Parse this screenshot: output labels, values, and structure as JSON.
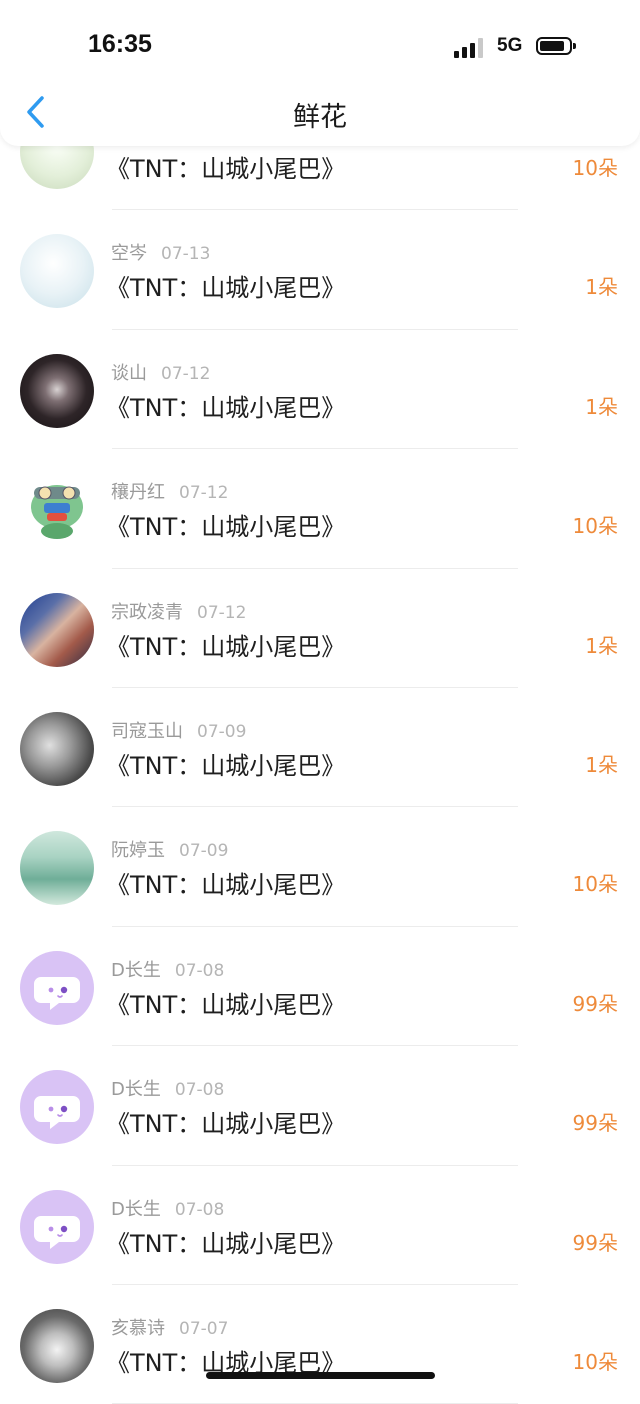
{
  "status_bar": {
    "time": "16:35",
    "network": "5G"
  },
  "header": {
    "title": "鲜花"
  },
  "rows": [
    {
      "name": "",
      "date": "",
      "book": "《TNT：山城小尾巴》",
      "amount": "10朵",
      "avatar": "av-partial",
      "avatar_name": "avatar-icon"
    },
    {
      "name": "空岑",
      "date": "07-13",
      "book": "《TNT：山城小尾巴》",
      "amount": "1朵",
      "avatar": "av-anime",
      "avatar_name": "avatar-icon"
    },
    {
      "name": "谈山",
      "date": "07-12",
      "book": "《TNT：山城小尾巴》",
      "amount": "1朵",
      "avatar": "av-dark",
      "avatar_name": "avatar-icon"
    },
    {
      "name": "穰丹红",
      "date": "07-12",
      "book": "《TNT：山城小尾巴》",
      "amount": "10朵",
      "avatar": "av-cartoon",
      "avatar_name": "avatar-icon"
    },
    {
      "name": "宗政凌青",
      "date": "07-12",
      "book": "《TNT：山城小尾巴》",
      "amount": "1朵",
      "avatar": "av-photo1",
      "avatar_name": "avatar-icon"
    },
    {
      "name": "司寇玉山",
      "date": "07-09",
      "book": "《TNT：山城小尾巴》",
      "amount": "1朵",
      "avatar": "av-bw",
      "avatar_name": "avatar-icon"
    },
    {
      "name": "阮婷玉",
      "date": "07-09",
      "book": "《TNT：山城小尾巴》",
      "amount": "10朵",
      "avatar": "av-forest",
      "avatar_name": "avatar-icon"
    },
    {
      "name": "D长生",
      "date": "07-08",
      "book": "《TNT：山城小尾巴》",
      "amount": "99朵",
      "avatar": "av-purple",
      "avatar_name": "default-chat-avatar-icon"
    },
    {
      "name": "D长生",
      "date": "07-08",
      "book": "《TNT：山城小尾巴》",
      "amount": "99朵",
      "avatar": "av-purple",
      "avatar_name": "default-chat-avatar-icon"
    },
    {
      "name": "D长生",
      "date": "07-08",
      "book": "《TNT：山城小尾巴》",
      "amount": "99朵",
      "avatar": "av-purple",
      "avatar_name": "default-chat-avatar-icon"
    },
    {
      "name": "亥慕诗",
      "date": "07-07",
      "book": "《TNT：山城小尾巴》",
      "amount": "10朵",
      "avatar": "av-portrait",
      "avatar_name": "avatar-icon"
    }
  ],
  "colors": {
    "accent": "#2f9bf0",
    "amount": "#ee8a3a",
    "default_avatar": "#d9c3f5"
  }
}
